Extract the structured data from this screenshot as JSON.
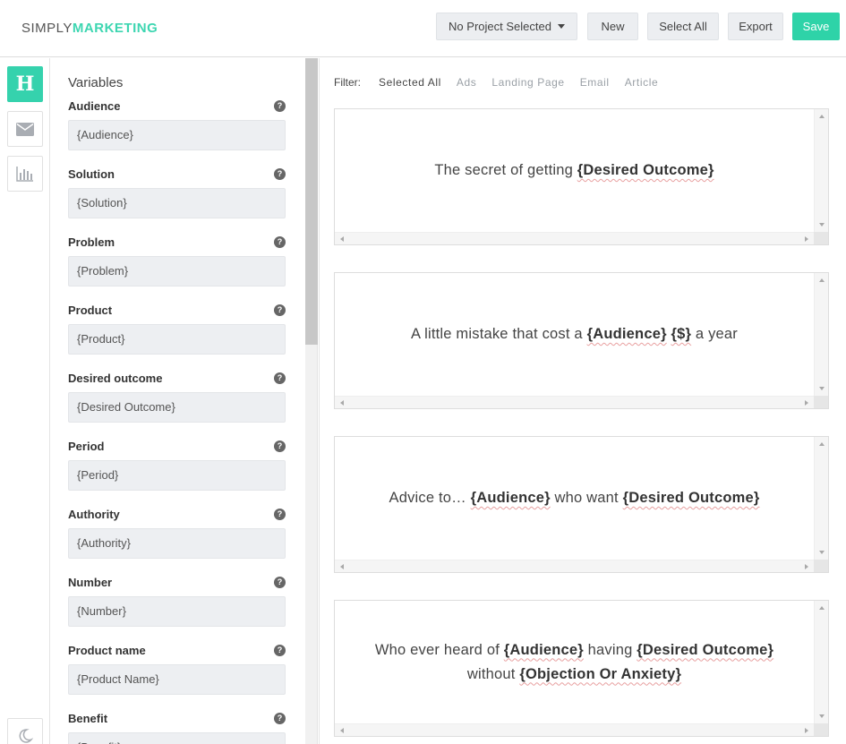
{
  "header": {
    "logo_part1": "SIMPLY",
    "logo_part2": "MARKETING",
    "project_select": "No Project Selected",
    "new_label": "New",
    "select_all_label": "Select All",
    "export_label": "Export",
    "save_label": "Save"
  },
  "rail": {
    "headline_letter": "H"
  },
  "variables": {
    "title": "Variables",
    "items": [
      {
        "label": "Audience",
        "value": "{Audience}"
      },
      {
        "label": "Solution",
        "value": "{Solution}"
      },
      {
        "label": "Problem",
        "value": "{Problem}"
      },
      {
        "label": "Product",
        "value": "{Product}"
      },
      {
        "label": "Desired outcome",
        "value": "{Desired Outcome}"
      },
      {
        "label": "Period",
        "value": "{Period}"
      },
      {
        "label": "Authority",
        "value": "{Authority}"
      },
      {
        "label": "Number",
        "value": "{Number}"
      },
      {
        "label": "Product name",
        "value": "{Product Name}"
      },
      {
        "label": "Benefit",
        "value": "{Benefit}"
      }
    ]
  },
  "filter": {
    "label": "Filter:",
    "options": [
      "Selected All",
      "Ads",
      "Landing Page",
      "Email",
      "Article"
    ],
    "selected": "Selected All"
  },
  "cards": [
    {
      "t1": "The secret of getting ",
      "v1": "{Desired Outcome}"
    },
    {
      "t1": "A little mistake that cost a ",
      "v1": "{Audience}",
      "t2": " ",
      "v2": "{$}",
      "t3": " a year"
    },
    {
      "t1": "Advice to… ",
      "v1": "{Audience}",
      "t2": " who want ",
      "v2": "{Desired Outcome}"
    },
    {
      "t1": "Who ever heard of ",
      "v1": "{Audience}",
      "t2": " having ",
      "v2": "{Desired Outcome}",
      "t3": " without ",
      "v3": "{Objection Or Anxiety}"
    }
  ],
  "colors": {
    "accent": "#2ed3a8",
    "input_bg": "#edeff2"
  }
}
